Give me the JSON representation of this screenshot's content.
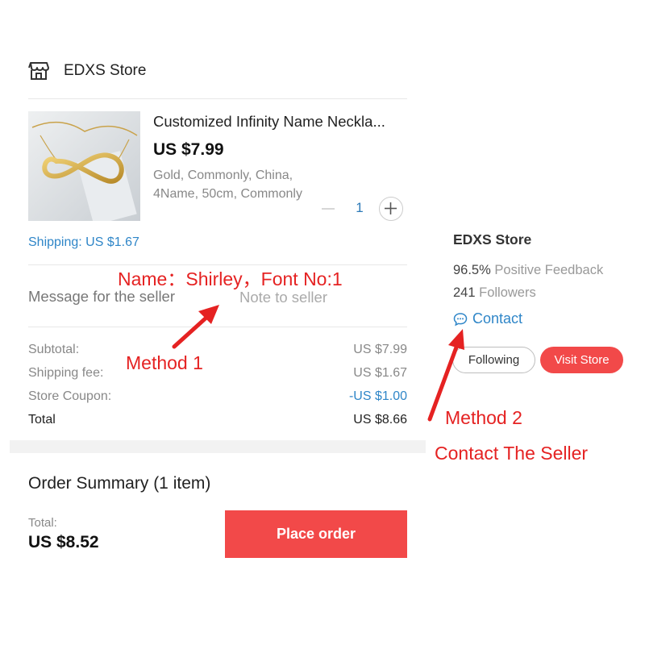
{
  "store": {
    "name": "EDXS Store",
    "icon": "store-icon"
  },
  "product": {
    "title": "Customized Infinity Name Neckla...",
    "price": "US $7.99",
    "variant": "Gold, Commonly, China, 4Name, 50cm, Commonly",
    "quantity": "1",
    "shipping": "Shipping: US $1.67",
    "image": "gold-infinity-name-necklace-photo"
  },
  "message": {
    "label": "Message for the seller",
    "placeholder": "Note to seller"
  },
  "costs": [
    {
      "label": "Subtotal:",
      "value": "US $7.99"
    },
    {
      "label": "Shipping fee:",
      "value": "US $1.67"
    },
    {
      "label": "Store Coupon:",
      "value": "-US $1.00"
    },
    {
      "label": "Total",
      "value": "US $8.66"
    }
  ],
  "summary": {
    "title": "Order Summary (1 item)",
    "total_label": "Total:",
    "total_value": "US $8.52",
    "place_order": "Place order"
  },
  "store_card": {
    "name": "EDXS Store",
    "feedback_value": "96.5%",
    "feedback_label": "Positive Feedback",
    "followers_value": "241",
    "followers_label": "Followers",
    "contact": "Contact",
    "following": "Following",
    "visit_store": "Visit Store"
  },
  "annotations": {
    "name_note": "Name：Shirley，Font No:1",
    "method1": "Method 1",
    "method2": "Method 2",
    "contact_seller": "Contact The Seller",
    "color": "#e52222"
  },
  "colors": {
    "accent_red": "#f24949",
    "link_blue": "#2f86c8"
  }
}
